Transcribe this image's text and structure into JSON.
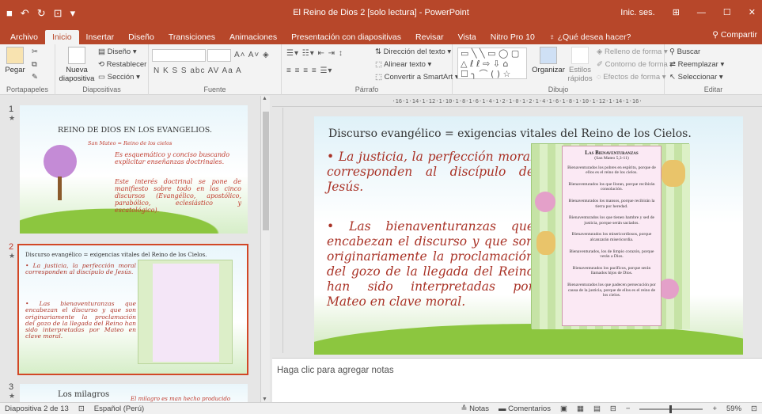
{
  "window": {
    "title": "El Reino de Dios 2 [solo lectura] - PowerPoint",
    "signin": "Inic. ses."
  },
  "tabs": [
    {
      "label": "Archivo"
    },
    {
      "label": "Inicio"
    },
    {
      "label": "Insertar"
    },
    {
      "label": "Diseño"
    },
    {
      "label": "Transiciones"
    },
    {
      "label": "Animaciones"
    },
    {
      "label": "Presentación con diapositivas"
    },
    {
      "label": "Revisar"
    },
    {
      "label": "Vista"
    },
    {
      "label": "Nitro Pro 10"
    }
  ],
  "tell_me": "¿Qué desea hacer?",
  "share": "Compartir",
  "ribbon": {
    "clipboard": {
      "paste": "Pegar",
      "label": "Portapapeles"
    },
    "slides": {
      "new_slide": "Nueva diapositiva",
      "layout": "Diseño",
      "reset": "Restablecer",
      "section": "Sección",
      "label": "Diapositivas"
    },
    "font": {
      "label": "Fuente",
      "format_buttons": "N K S S abc AV Aa A"
    },
    "paragraph": {
      "direction": "Dirección del texto",
      "align": "Alinear texto",
      "smartart": "Convertir a SmartArt",
      "label": "Párrafo"
    },
    "drawing": {
      "arrange": "Organizar",
      "styles": "Estilos rápidos",
      "fill": "Relleno de forma",
      "outline": "Contorno de forma",
      "effects": "Efectos de forma",
      "label": "Dibujo"
    },
    "editing": {
      "find": "Buscar",
      "replace": "Reemplazar",
      "select": "Seleccionar",
      "label": "Editar"
    }
  },
  "thumbs": [
    {
      "num": "1",
      "title": "REINO DE DIOS EN LOS EVANGELIOS.",
      "subtitle": "San Mateo = Reino de los cielos",
      "p1": "Es esquemático y conciso buscando explicitar enseñanzas doctrinales.",
      "p2": "Este interés doctrinal se pone de manifiesto sobre todo en los cinco discursos (Evangélico, apostólico, parabólico, eclesiástico y escatológico)."
    },
    {
      "num": "2",
      "title": "Discurso evangélico = exigencias vitales del Reino de los Cielos."
    },
    {
      "num": "3",
      "title": "Los milagros",
      "subtitle": "El milagro es man hecho producido"
    }
  ],
  "slide": {
    "title": "Discurso evangélico = exigencias vitales del Reino de los Cielos.",
    "bullets": [
      "La justicia, la perfección moral corresponden al discípulo de Jesús.",
      "Las bienaventuranzas que encabezan el discurso y que son originariamente la proclamación del gozo de la llegada del Reino han sido interpretadas por Mateo en clave moral."
    ],
    "box": {
      "heading": "Las Bienaventuranzas",
      "ref": "(San Mateo 5,3-11)",
      "lines": [
        "Bienaventurados los pobres en espíritu, porque de ellos es el reino de los cielos.",
        "Bienaventurados los que lloran, porque recibirán consolación.",
        "Bienaventurados los mansos, porque recibirán la tierra por heredad.",
        "Bienaventurados los que tienen hambre y sed de justicia, porque serán saciados.",
        "Bienaventurados los misericordiosos, porque alcanzarán misericordia.",
        "Bienaventurados, los de limpio corazón, porque verán a Dios.",
        "Bienaventurados los pacíficos, porque serán llamados hijos de Dios.",
        "Bienaventurados los que padecen persecución por causa de la justicia, porque de ellos es el reino de los cielos."
      ]
    }
  },
  "ruler_text": "·16·1·14·1·12·1·10·1·8·1·6·1·4·1·2·1·0·1·2·1·4·1·6·1·8·1·10·1·12·1·14·1·16·",
  "notes_placeholder": "Haga clic para agregar notas",
  "status": {
    "slide_of": "Diapositiva 2 de 13",
    "language": "Español (Perú)",
    "notes": "Notas",
    "comments": "Comentarios",
    "zoom": "59%"
  },
  "colors": {
    "accent": "#b7472a",
    "ribbon": "#f3f3f3"
  }
}
